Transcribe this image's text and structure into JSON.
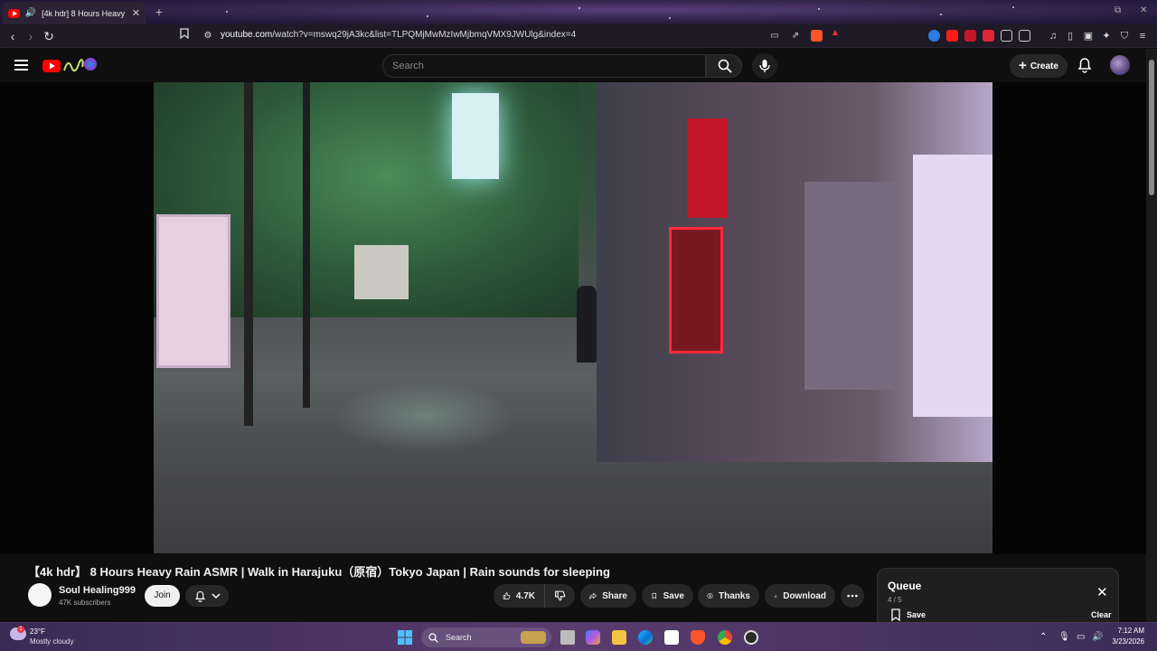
{
  "browser": {
    "tab_title": "[4k hdr] 8 Hours Heavy Rain",
    "url_domain": "youtube.com",
    "url_path": "/watch?v=mswq29jA3kc&list=TLPQMjMwMzIwMjbmqVMX9JWUlg&index=4"
  },
  "masthead": {
    "search_placeholder": "Search",
    "create_label": "Create"
  },
  "video": {
    "title": "【4k hdr】 8 Hours Heavy Rain ASMR | Walk in Harajuku（原宿）Tokyo Japan | Rain sounds for sleeping",
    "channel_name": "Soul Healing999",
    "subscribers": "47K subscribers",
    "join_label": "Join",
    "like_count": "4.7K",
    "share_label": "Share",
    "save_label": "Save",
    "thanks_label": "Thanks",
    "download_label": "Download"
  },
  "queue": {
    "title": "Queue",
    "count": "4 / 5",
    "save_label": "Save",
    "clear_label": "Clear"
  },
  "taskbar": {
    "temperature": "23°F",
    "weather": "Mostly cloudy",
    "search_label": "Search",
    "time": "7:12 AM",
    "date": "3/23/2026"
  },
  "colors": {
    "youtube_red": "#ff0000",
    "background": "#0f0f0f",
    "pill_bg": "#272727"
  }
}
